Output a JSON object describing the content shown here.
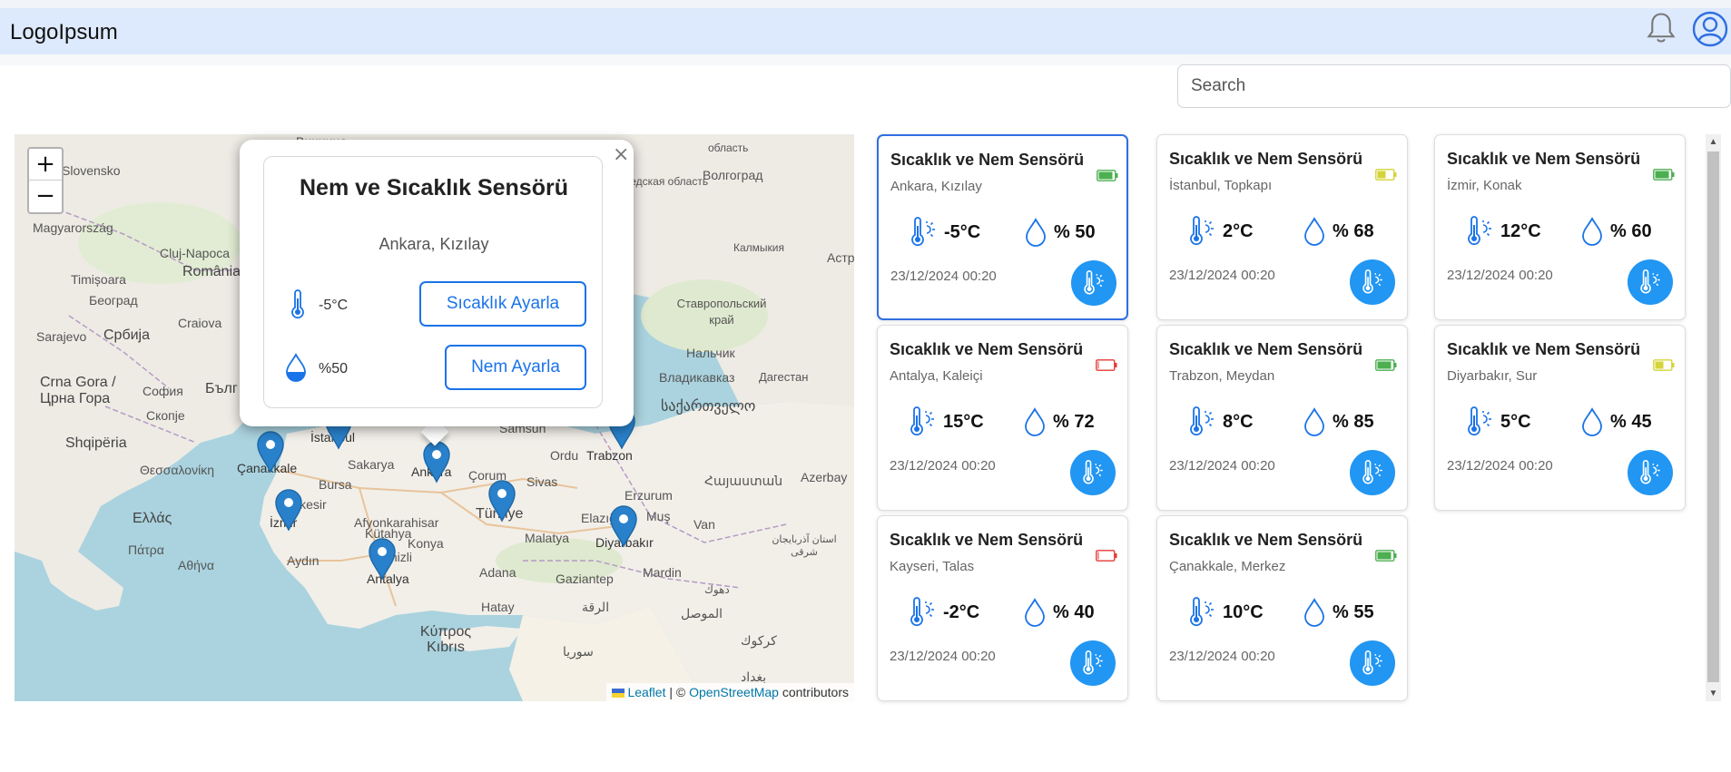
{
  "header": {
    "logo": "LogoIpsum",
    "bell_icon": "bell-icon",
    "user_icon": "user-circle-icon"
  },
  "search": {
    "placeholder": "Search"
  },
  "map": {
    "zoom_in": "+",
    "zoom_out": "−",
    "attribution": {
      "leaflet": "Leaflet",
      "separator": " | © ",
      "osm": "OpenStreetMap",
      "suffix": " contributors"
    },
    "labels": [
      "Slovensko",
      "Magyarország",
      "Cluj-Napoca",
      "România",
      "Timișoara",
      "Београд",
      "Craiova",
      "Србија",
      "Sarajevo",
      "Crna Gora / Црна Гора",
      "Скопје",
      "Shqipëria",
      "София",
      "Бълг",
      "Θεσσαλονίκη",
      "Ελλάς",
      "Πάτρα",
      "Αθήνα",
      "Çanakkale",
      "İstanbul",
      "Bursa",
      "Sakarya",
      "Ankara",
      "Çorum",
      "Samsun",
      "Ordu",
      "Trabzon",
      "Sivas",
      "Erzurum",
      "Balıkesir",
      "Kütahya",
      "Afyonkarahisar",
      "İzmir",
      "Aydın",
      "Konya",
      "Denizli",
      "Antalya",
      "Türkiye",
      "Malatya",
      "Elazığ",
      "Muş",
      "Van",
      "Diyarbakır",
      "Mardin",
      "Adana",
      "Gaziantep",
      "Hatay",
      "Κύπρος Kıbrıs",
      "سوريا",
      "الرقة",
      "الموصل",
      "كركوك",
      "بغداد",
      "Волгоград",
      "Калмыкия",
      "Астр",
      "Ставропольский край",
      "Нальчик",
      "Владикавказ",
      "Дагестан",
      "საქართველო",
      "Հայաստան",
      "Azerbay",
      "استان آذربایجان شرقی",
      "دهوك",
      "ведская область",
      "область",
      "Винница"
    ],
    "popup": {
      "title": "Nem ve Sıcaklık Sensörü",
      "location": "Ankara, Kızılay",
      "temp": "-5°C",
      "temp_button": "Sıcaklık Ayarla",
      "humidity": "%50",
      "humidity_button": "Nem Ayarla",
      "close": "×"
    }
  },
  "cards": [
    {
      "title": "Sıcaklık ve Nem Sensörü",
      "location": "Ankara, Kızılay",
      "temp": "-5°C",
      "humidity": "% 50",
      "date": "23/12/2024 00:20",
      "battery_color": "#4caf50",
      "battery_level": 0.85
    },
    {
      "title": "Sıcaklık ve Nem Sensörü",
      "location": "İstanbul, Topkapı",
      "temp": "2°C",
      "humidity": "% 68",
      "date": "23/12/2024 00:20",
      "battery_color": "#d4d43a",
      "battery_level": 0.5
    },
    {
      "title": "Sıcaklık ve Nem Sensörü",
      "location": "İzmir, Konak",
      "temp": "12°C",
      "humidity": "% 60",
      "date": "23/12/2024 00:20",
      "battery_color": "#4caf50",
      "battery_level": 0.85
    },
    {
      "title": "Sıcaklık ve Nem Sensörü",
      "location": "Antalya, Kaleiçi",
      "temp": "15°C",
      "humidity": "% 72",
      "date": "23/12/2024 00:20",
      "battery_color": "#e53935",
      "battery_level": 0.05
    },
    {
      "title": "Sıcaklık ve Nem Sensörü",
      "location": "Trabzon, Meydan",
      "temp": "8°C",
      "humidity": "% 85",
      "date": "23/12/2024 00:20",
      "battery_color": "#4caf50",
      "battery_level": 0.85
    },
    {
      "title": "Sıcaklık ve Nem Sensörü",
      "location": "Diyarbakır, Sur",
      "temp": "5°C",
      "humidity": "% 45",
      "date": "23/12/2024 00:20",
      "battery_color": "#d4d43a",
      "battery_level": 0.5
    },
    {
      "title": "Sıcaklık ve Nem Sensörü",
      "location": "Kayseri, Talas",
      "temp": "-2°C",
      "humidity": "% 40",
      "date": "23/12/2024 00:20",
      "battery_color": "#e53935",
      "battery_level": 0.05
    },
    {
      "title": "Sıcaklık ve Nem Sensörü",
      "location": "Çanakkale, Merkez",
      "temp": "10°C",
      "humidity": "% 55",
      "date": "23/12/2024 00:20",
      "battery_color": "#4caf50",
      "battery_level": 0.85
    }
  ],
  "icons": {
    "temp_humidity_icon": "thermometer-sun-icon",
    "humidity_icon": "droplet-icon",
    "card_button_icon": "thermometer-sun-icon"
  },
  "colors": {
    "accent": "#2196f3",
    "header_bg": "#dde9fc",
    "active_border": "#2f6fe0"
  }
}
